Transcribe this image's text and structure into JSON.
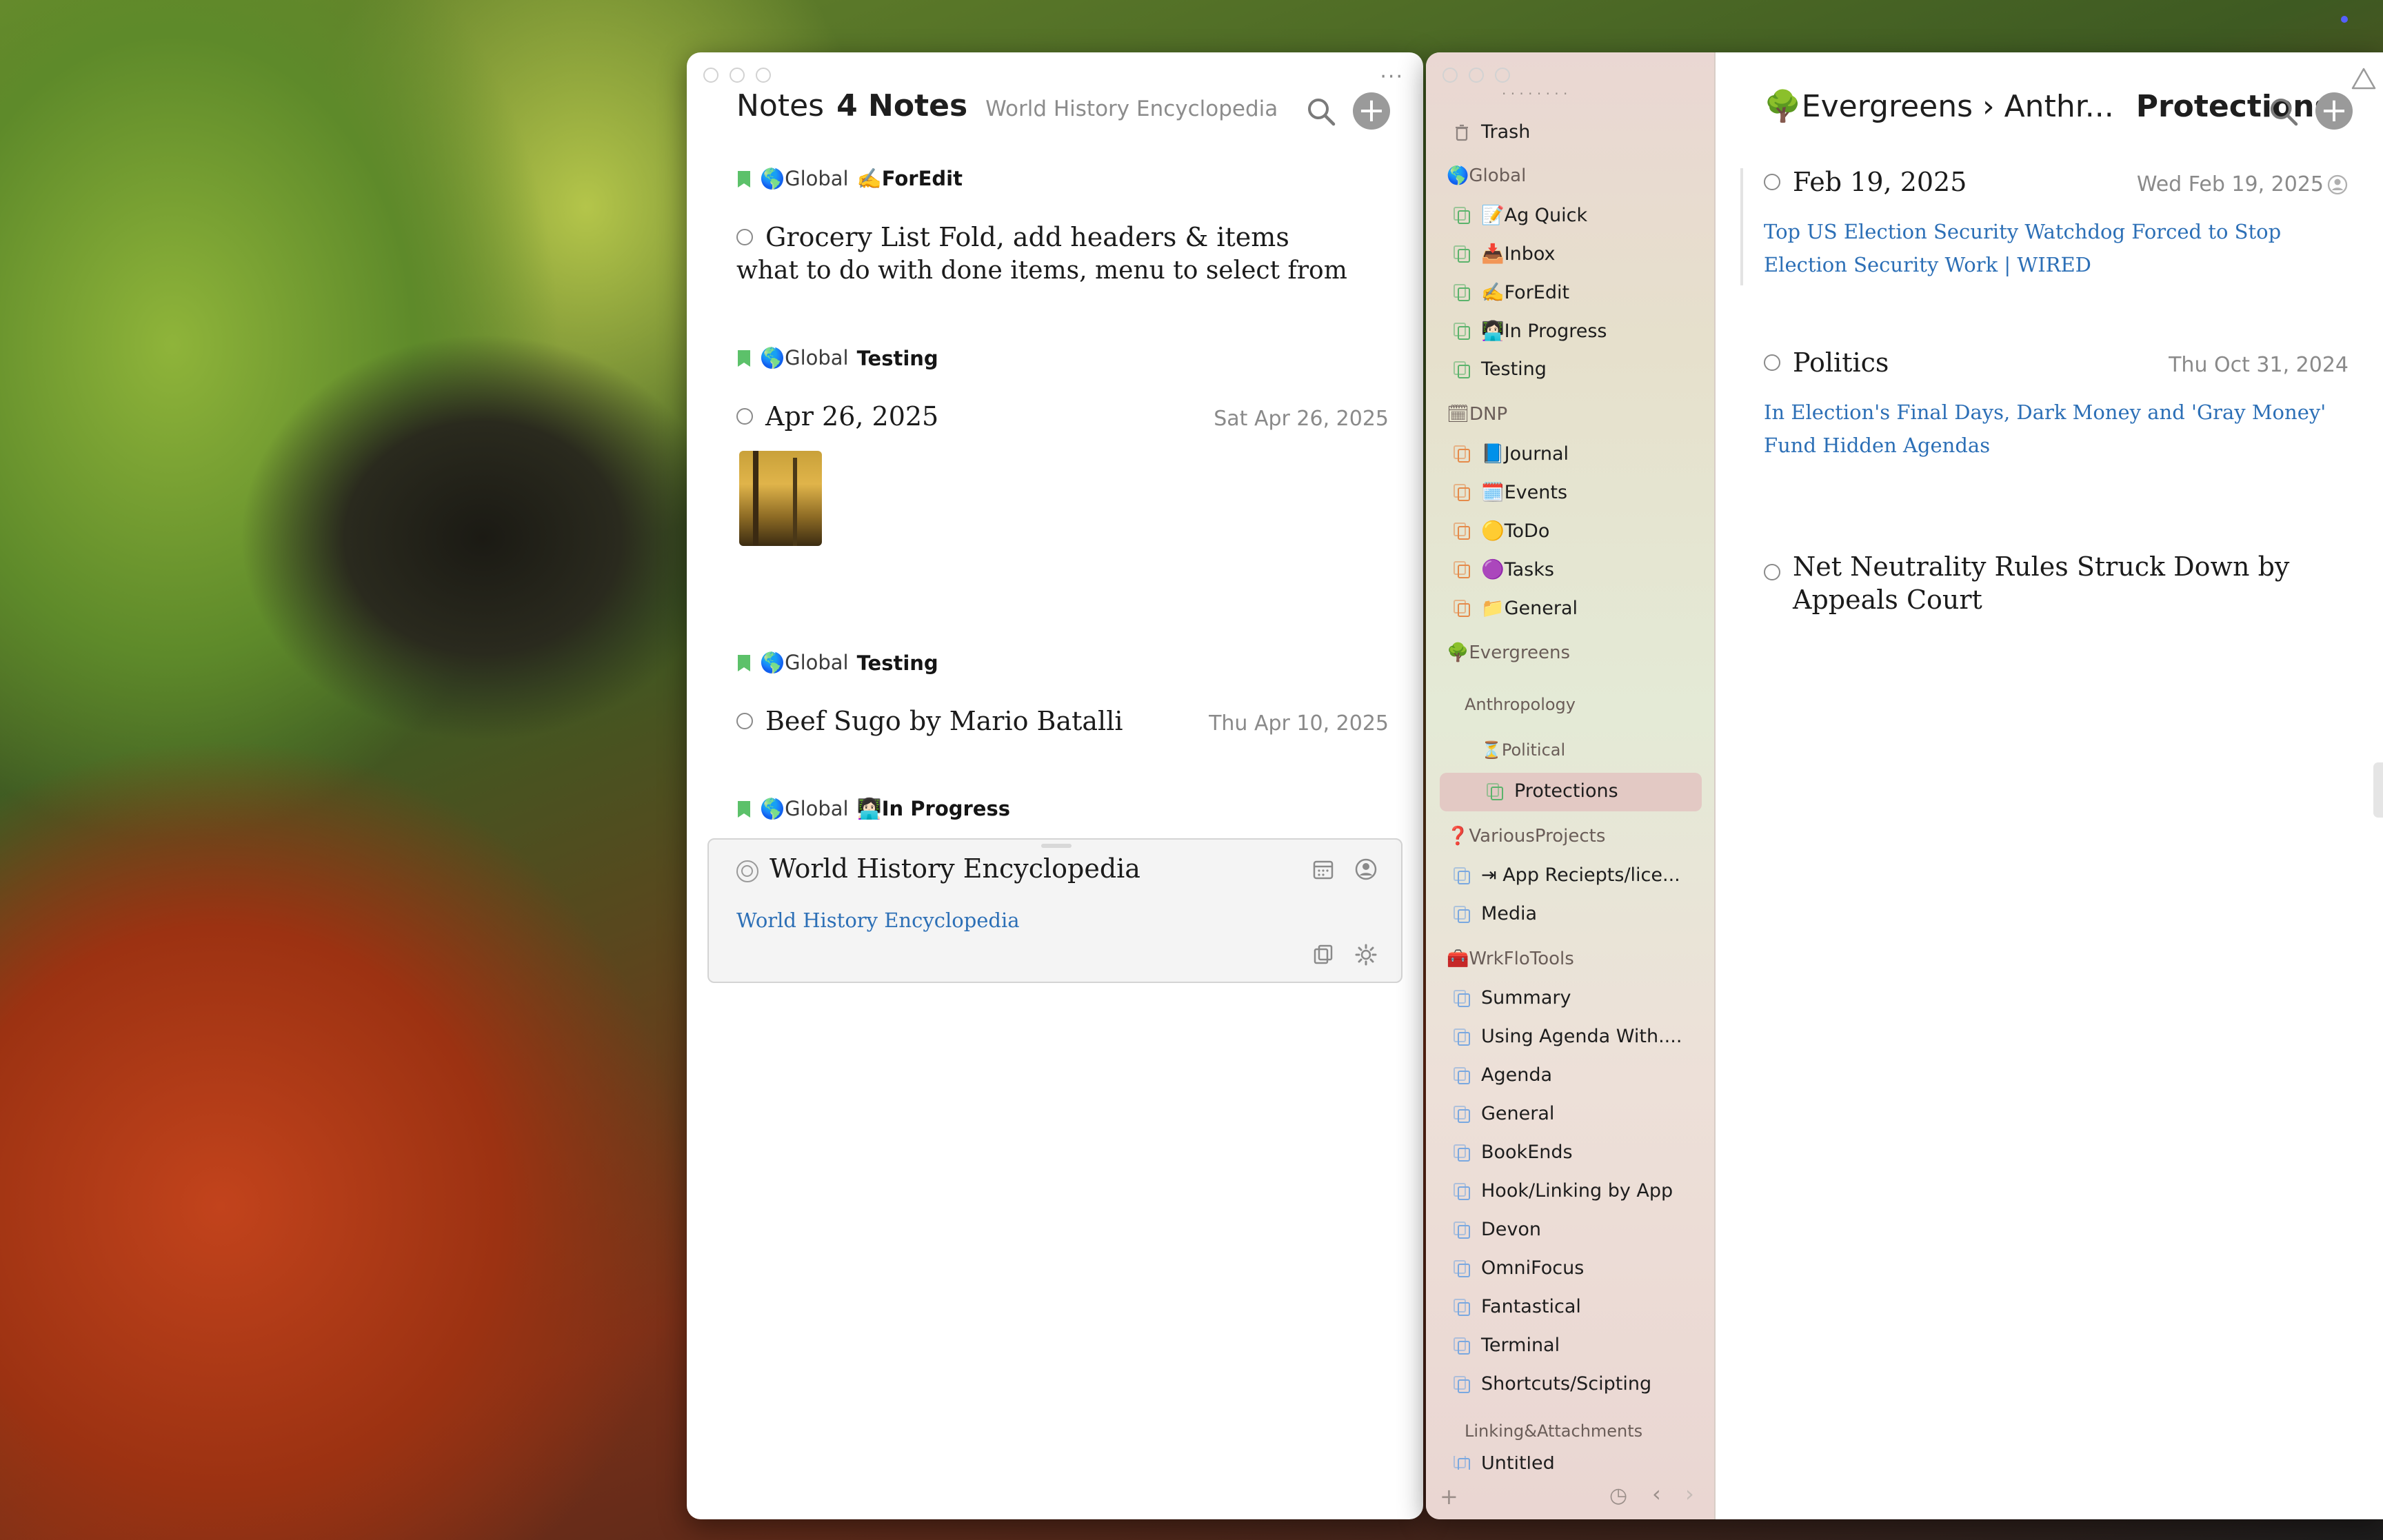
{
  "left_window": {
    "title": "Notes",
    "count": "4 Notes",
    "subtitle": "World History Encyclopedia",
    "menu": "···",
    "groups": [
      {
        "area": "🌎Global",
        "category": "✍️ForEdit",
        "note_title": "Grocery List Fold, add headers & items",
        "note_body": "what to do with done items, menu to select from",
        "date": ""
      },
      {
        "area": "🌎Global",
        "category": "Testing",
        "note_title": "Apr 26, 2025",
        "date": "Sat Apr 26, 2025"
      },
      {
        "area": "🌎Global",
        "category": "Testing",
        "note_title": "Beef Sugo by Mario Batalli",
        "date": "Thu Apr 10, 2025"
      },
      {
        "area": "🌎Global",
        "category": "👩🏻‍💻In Progress",
        "note_title": "World History Encyclopedia",
        "link": "World History Encyclopedia"
      }
    ]
  },
  "sidebar": {
    "partial_top": "· · · · · · · ·",
    "items": [
      {
        "label": "Trash"
      },
      {
        "label": "🌎Global",
        "type": "header"
      },
      {
        "label": "📝Ag Quick"
      },
      {
        "label": "📥Inbox"
      },
      {
        "label": "✍️ForEdit"
      },
      {
        "label": "👩🏻‍💻In Progress"
      },
      {
        "label": "Testing"
      },
      {
        "label": "🗓DNP",
        "type": "header"
      },
      {
        "label": "📘Journal"
      },
      {
        "label": "🗓️Events"
      },
      {
        "label": "🟡ToDo"
      },
      {
        "label": "🟣Tasks"
      },
      {
        "label": "📁General"
      },
      {
        "label": "🌳Evergreens",
        "type": "header"
      },
      {
        "label": "Anthropology",
        "type": "sub"
      },
      {
        "label": "⏳Political",
        "type": "sub2"
      },
      {
        "label": "Protections",
        "selected": true
      },
      {
        "label": "❓VariousProjects",
        "type": "header"
      },
      {
        "label": "⇥ App Reciepts/lice..."
      },
      {
        "label": "Media"
      },
      {
        "label": "🧰WrkFloTools",
        "type": "header"
      },
      {
        "label": "Summary"
      },
      {
        "label": "Using Agenda With...."
      },
      {
        "label": "Agenda"
      },
      {
        "label": "General"
      },
      {
        "label": "BookEnds"
      },
      {
        "label": "Hook/Linking by App"
      },
      {
        "label": "Devon"
      },
      {
        "label": "OmniFocus"
      },
      {
        "label": "Fantastical"
      },
      {
        "label": "Terminal"
      },
      {
        "label": "Shortcuts/Scipting"
      },
      {
        "label": "Linking&Attachments",
        "type": "sub"
      },
      {
        "label": "Untitled"
      }
    ],
    "footer": {
      "add": "+",
      "history": "◷",
      "back": "‹",
      "forward": "›"
    }
  },
  "right_main": {
    "breadcrumb": "🌳Evergreens › Anthr...",
    "current": "Protections",
    "notes": [
      {
        "title": "Feb 19, 2025",
        "date": "Wed Feb 19, 2025",
        "link": "Top US Election Security Watchdog Forced to Stop Election Security Work | WIRED"
      },
      {
        "title": "Politics",
        "date": "Thu Oct 31, 2024",
        "link": "In Election's Final Days, Dark Money and 'Gray Money' Fund Hidden Agendas"
      },
      {
        "title": "Net Neutrality Rules Struck Down by Appeals Court"
      }
    ]
  },
  "colors": {
    "link": "#2c6fb6",
    "flag": "#5cc16a",
    "sidebar_global_icon": "#5bb36c",
    "sidebar_dnp_icon": "#e58a4a",
    "sidebar_misc_icon": "#7aa8e0"
  }
}
